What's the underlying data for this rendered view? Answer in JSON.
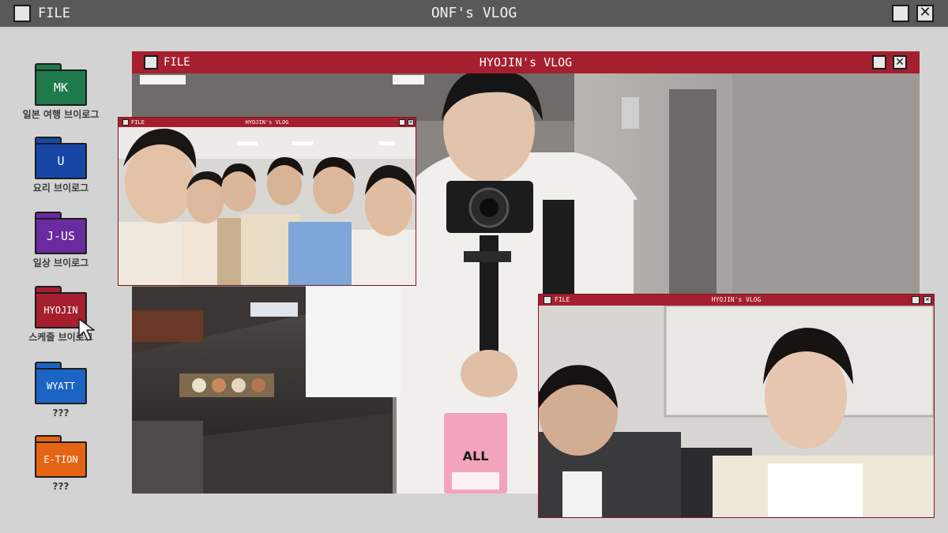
{
  "top_bar": {
    "file_label": "FILE",
    "title": "ONF's VLOG",
    "minimize_glyph": "",
    "close_glyph": "✕"
  },
  "folders": [
    {
      "label": "MK",
      "caption": "일본 여행 브이로그",
      "color": "#1f7a4b"
    },
    {
      "label": "U",
      "caption": "요리 브이로그",
      "color": "#1846a6"
    },
    {
      "label": "J-US",
      "caption": "일상 브이로그",
      "color": "#6a2aa0"
    },
    {
      "label": "HYOJIN",
      "caption": "스케줄 브이로그",
      "color": "#a51f2f"
    },
    {
      "label": "WYATT",
      "caption": "???",
      "color": "#1b64c4"
    },
    {
      "label": "E-TION",
      "caption": "???",
      "color": "#e56415"
    }
  ],
  "windows": {
    "main": {
      "file_label": "FILE",
      "title": "HYOJIN's VLOG",
      "close_glyph": "✕"
    },
    "group": {
      "file_label": "FILE",
      "title": "HYOJIN's VLOG",
      "close_glyph": "✕"
    },
    "third": {
      "file_label": "FILE",
      "title": "HYOJIN's VLOG",
      "close_glyph": "✕"
    }
  },
  "badge": {
    "text": "ALL"
  },
  "colors": {
    "desktop": "#d3d3d3",
    "top_bar": "#595959",
    "window_title_bar": "#a51f2f"
  }
}
